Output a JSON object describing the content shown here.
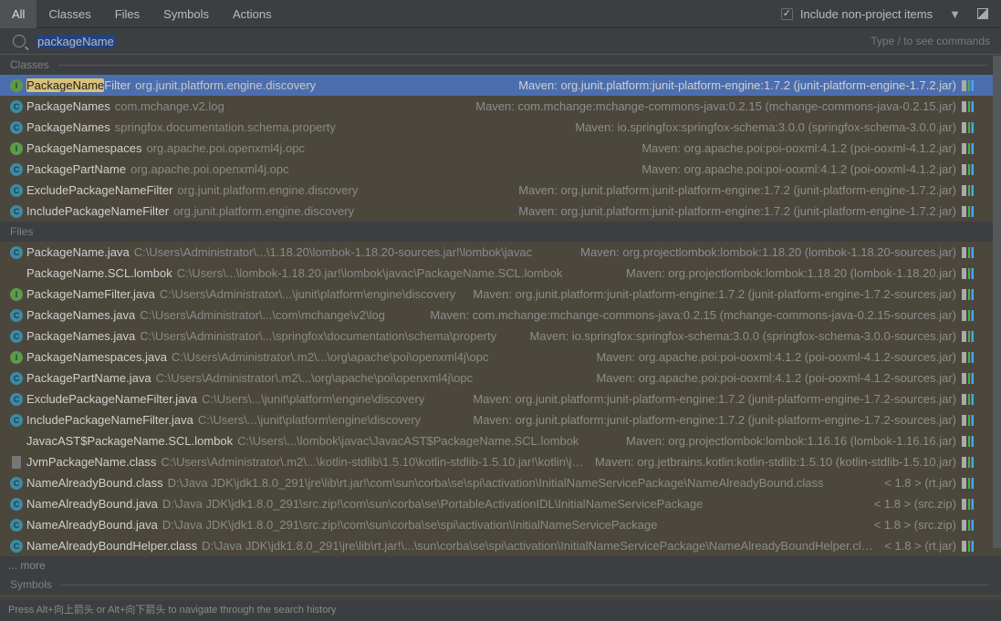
{
  "tabs": [
    "All",
    "Classes",
    "Files",
    "Symbols",
    "Actions"
  ],
  "include_label": "Include non-project items",
  "include_checked": true,
  "search": {
    "value": "packageName",
    "hint": "Type / to see commands"
  },
  "colors": {
    "selected": "#4b6eaf",
    "row_bg": "#4b473c",
    "highlight": "#d9c178"
  },
  "sections": {
    "classes": "Classes",
    "files": "Files",
    "symbols": "Symbols"
  },
  "classes": [
    {
      "icon": "i",
      "pre": "",
      "hl": "PackageName",
      "post": "Filter",
      "path": "org.junit.platform.engine.discovery",
      "loc": "Maven: org.junit.platform:junit-platform-engine:1.7.2 (junit-platform-engine-1.7.2.jar)",
      "selected": true
    },
    {
      "icon": "c",
      "pre": "",
      "hl": "",
      "post": "PackageNames",
      "path": "com.mchange.v2.log",
      "loc": "Maven: com.mchange:mchange-commons-java:0.2.15 (mchange-commons-java-0.2.15.jar)"
    },
    {
      "icon": "c",
      "pre": "",
      "hl": "",
      "post": "PackageNames",
      "path": "springfox.documentation.schema.property",
      "loc": "Maven: io.springfox:springfox-schema:3.0.0 (springfox-schema-3.0.0.jar)"
    },
    {
      "icon": "i",
      "pre": "",
      "hl": "",
      "post": "PackageNamespaces",
      "path": "org.apache.poi.openxml4j.opc",
      "loc": "Maven: org.apache.poi:poi-ooxml:4.1.2 (poi-ooxml-4.1.2.jar)"
    },
    {
      "icon": "c",
      "pre": "",
      "hl": "",
      "post": "PackagePartName",
      "path": "org.apache.poi.openxml4j.opc",
      "loc": "Maven: org.apache.poi:poi-ooxml:4.1.2 (poi-ooxml-4.1.2.jar)"
    },
    {
      "icon": "c",
      "pre": "",
      "hl": "",
      "post": "ExcludePackageNameFilter",
      "path": "org.junit.platform.engine.discovery",
      "loc": "Maven: org.junit.platform:junit-platform-engine:1.7.2 (junit-platform-engine-1.7.2.jar)"
    },
    {
      "icon": "c",
      "pre": "",
      "hl": "",
      "post": "IncludePackageNameFilter",
      "path": "org.junit.platform.engine.discovery",
      "loc": "Maven: org.junit.platform:junit-platform-engine:1.7.2 (junit-platform-engine-1.7.2.jar)"
    }
  ],
  "files": [
    {
      "icon": "c",
      "post": "PackageName.java",
      "path": "C:\\Users\\Administrator\\...\\1.18.20\\lombok-1.18.20-sources.jar!\\lombok\\javac",
      "loc": "Maven: org.projectlombok:lombok:1.18.20 (lombok-1.18.20-sources.jar)"
    },
    {
      "icon": "none",
      "post": "PackageName.SCL.lombok",
      "path": "C:\\Users\\...\\lombok-1.18.20.jar!\\lombok\\javac\\PackageName.SCL.lombok",
      "loc": "Maven: org.projectlombok:lombok:1.18.20 (lombok-1.18.20.jar)"
    },
    {
      "icon": "i",
      "post": "PackageNameFilter.java",
      "path": "C:\\Users\\Administrator\\...\\junit\\platform\\engine\\discovery",
      "loc": "Maven: org.junit.platform:junit-platform-engine:1.7.2 (junit-platform-engine-1.7.2-sources.jar)"
    },
    {
      "icon": "c",
      "post": "PackageNames.java",
      "path": "C:\\Users\\Administrator\\...\\com\\mchange\\v2\\log",
      "loc": "Maven: com.mchange:mchange-commons-java:0.2.15 (mchange-commons-java-0.2.15-sources.jar)"
    },
    {
      "icon": "c",
      "post": "PackageNames.java",
      "path": "C:\\Users\\Administrator\\...\\springfox\\documentation\\schema\\property",
      "loc": "Maven: io.springfox:springfox-schema:3.0.0 (springfox-schema-3.0.0-sources.jar)"
    },
    {
      "icon": "i",
      "post": "PackageNamespaces.java",
      "path": "C:\\Users\\Administrator\\.m2\\...\\org\\apache\\poi\\openxml4j\\opc",
      "loc": "Maven: org.apache.poi:poi-ooxml:4.1.2 (poi-ooxml-4.1.2-sources.jar)"
    },
    {
      "icon": "c",
      "post": "PackagePartName.java",
      "path": "C:\\Users\\Administrator\\.m2\\...\\org\\apache\\poi\\openxml4j\\opc",
      "loc": "Maven: org.apache.poi:poi-ooxml:4.1.2 (poi-ooxml-4.1.2-sources.jar)"
    },
    {
      "icon": "c",
      "post": "ExcludePackageNameFilter.java",
      "path": "C:\\Users\\...\\junit\\platform\\engine\\discovery",
      "loc": "Maven: org.junit.platform:junit-platform-engine:1.7.2 (junit-platform-engine-1.7.2-sources.jar)"
    },
    {
      "icon": "c",
      "post": "IncludePackageNameFilter.java",
      "path": "C:\\Users\\...\\junit\\platform\\engine\\discovery",
      "loc": "Maven: org.junit.platform:junit-platform-engine:1.7.2 (junit-platform-engine-1.7.2-sources.jar)"
    },
    {
      "icon": "none",
      "post": "JavacAST$PackageName.SCL.lombok",
      "path": "C:\\Users\\...\\lombok\\javac\\JavacAST$PackageName.SCL.lombok",
      "loc": "Maven: org.projectlombok:lombok:1.16.16 (lombok-1.16.16.jar)"
    },
    {
      "icon": "k",
      "post": "JvmPackageName.class",
      "path": "C:\\Users\\Administrator\\.m2\\...\\kotlin-stdlib\\1.5.10\\kotlin-stdlib-1.5.10.jar!\\kotlin\\jvm",
      "loc": "Maven: org.jetbrains.kotlin:kotlin-stdlib:1.5.10 (kotlin-stdlib-1.5.10.jar)"
    },
    {
      "icon": "c",
      "post": "NameAlreadyBound.class",
      "path": "D:\\Java JDK\\jdk1.8.0_291\\jre\\lib\\rt.jar!\\com\\sun\\corba\\se\\spi\\activation\\InitialNameServicePackage\\NameAlreadyBound.class",
      "loc": "< 1.8 > (rt.jar)"
    },
    {
      "icon": "c",
      "post": "NameAlreadyBound.java",
      "path": "D:\\Java JDK\\jdk1.8.0_291\\src.zip!\\com\\sun\\corba\\se\\PortableActivationIDL\\InitialNameServicePackage",
      "loc": "< 1.8 > (src.zip)"
    },
    {
      "icon": "c",
      "post": "NameAlreadyBound.java",
      "path": "D:\\Java JDK\\jdk1.8.0_291\\src.zip!\\com\\sun\\corba\\se\\spi\\activation\\InitialNameServicePackage",
      "loc": "< 1.8 > (src.zip)"
    },
    {
      "icon": "c",
      "post": "NameAlreadyBoundHelper.class",
      "path": "D:\\Java JDK\\jdk1.8.0_291\\jre\\lib\\rt.jar!\\...\\sun\\corba\\se\\spi\\activation\\InitialNameServicePackage\\NameAlreadyBoundHelper.class",
      "loc": "< 1.8 > (rt.jar)"
    }
  ],
  "more": "... more",
  "status": "Press Alt+向上箭头 or Alt+向下箭头 to navigate through the search history"
}
